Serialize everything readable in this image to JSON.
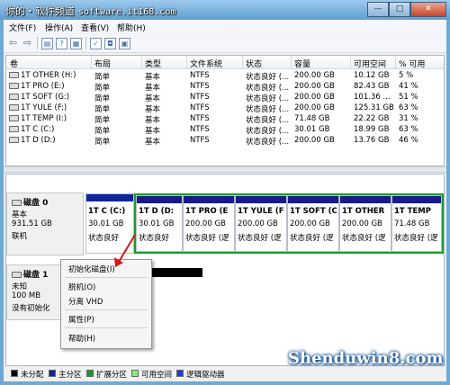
{
  "window": {
    "title_cn": "你的・软件频道",
    "title_url": "software.it168.com",
    "minimize": "—",
    "maximize": "□",
    "close": "✕"
  },
  "menu": [
    "文件(F)",
    "操作(A)",
    "查看(V)",
    "帮助(H)"
  ],
  "volume_list": {
    "columns": [
      "卷",
      "布局",
      "类型",
      "文件系统",
      "状态",
      "容量",
      "可用空间",
      "% 可用"
    ],
    "rows": [
      {
        "name": "1T OTHER (H:)",
        "layout": "简单",
        "type": "基本",
        "fs": "NTFS",
        "status": "状态良好 (...",
        "capacity": "200.00 GB",
        "free": "10.12 GB",
        "pct": "5 %"
      },
      {
        "name": "1T PRO (E:)",
        "layout": "简单",
        "type": "基本",
        "fs": "NTFS",
        "status": "状态良好 (...",
        "capacity": "200.00 GB",
        "free": "82.43 GB",
        "pct": "41 %"
      },
      {
        "name": "1T SOFT (G:)",
        "layout": "简单",
        "type": "基本",
        "fs": "NTFS",
        "status": "状态良好 (...",
        "capacity": "200.00 GB",
        "free": "101.36 ...",
        "pct": "51 %"
      },
      {
        "name": "1T YULE (F:)",
        "layout": "简单",
        "type": "基本",
        "fs": "NTFS",
        "status": "状态良好 (...",
        "capacity": "200.00 GB",
        "free": "125.31 GB",
        "pct": "63 %"
      },
      {
        "name": "1T TEMP (I:)",
        "layout": "简单",
        "type": "基本",
        "fs": "NTFS",
        "status": "状态良好 (...",
        "capacity": "71.48 GB",
        "free": "22.22 GB",
        "pct": "31 %"
      },
      {
        "name": "1T C (C:)",
        "layout": "简单",
        "type": "基本",
        "fs": "NTFS",
        "status": "状态良好 (...",
        "capacity": "30.01 GB",
        "free": "18.99 GB",
        "pct": "63 %"
      },
      {
        "name": "1T D (D:)",
        "layout": "简单",
        "type": "基本",
        "fs": "NTFS",
        "status": "状态良好 (...",
        "capacity": "200.00 GB",
        "free": "13.76 GB",
        "pct": "46 %"
      }
    ]
  },
  "disk0": {
    "title": "磁盘 0",
    "type": "基本",
    "size": "931.51 GB",
    "status": "联机",
    "partitions": [
      {
        "name": "1T C (C:)",
        "size": "30.01 GB",
        "status": "状态良好"
      },
      {
        "name": "1T D (D:",
        "size": "30.01 GB",
        "status": "状态良好"
      },
      {
        "name": "1T PRO (E",
        "size": "200.00 GB",
        "status": "状态良好 (逻"
      },
      {
        "name": "1T YULE (F",
        "size": "200.00 GB",
        "status": "状态良好 (逻"
      },
      {
        "name": "1T SOFT (C",
        "size": "200.00 GB",
        "status": "状态良好 (逻"
      },
      {
        "name": "1T OTHER",
        "size": "200.00 GB",
        "status": "状态良好 (逻"
      },
      {
        "name": "1T TEMP",
        "size": "71.48 GB",
        "status": "状态良好 (逻"
      }
    ]
  },
  "disk1": {
    "title": "磁盘 1",
    "type": "未知",
    "size": "100 MB",
    "status": "没有初始化"
  },
  "context_menu": {
    "initialize": "初始化磁盘(I)",
    "offline": "脱机(O)",
    "detach_vhd": "分离 VHD",
    "properties": "属性(P)",
    "help": "帮助(H)"
  },
  "legend": [
    {
      "label": "未分配",
      "color": "#000000"
    },
    {
      "label": "主分区",
      "color": "#10249a"
    },
    {
      "label": "扩展分区",
      "color": "#1d9a2e"
    },
    {
      "label": "可用空间",
      "color": "#7cf07c"
    },
    {
      "label": "逻辑驱动器",
      "color": "#1b3cd8"
    }
  ],
  "watermark": "Shenduwin8.com",
  "colors": {
    "accent_green": "#1d9a2e",
    "primary_blue": "#10249a",
    "unallocated": "#000000"
  }
}
